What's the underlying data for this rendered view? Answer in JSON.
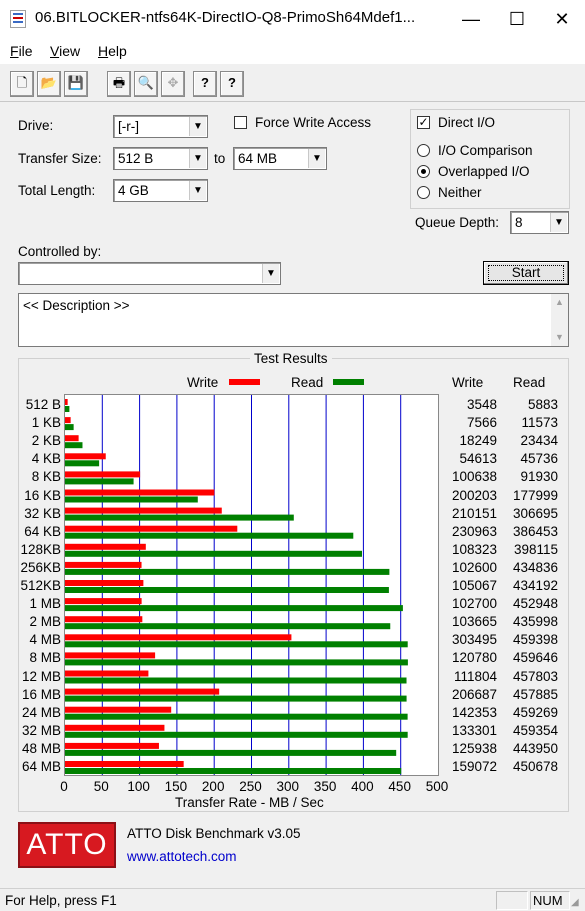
{
  "window": {
    "title": "06.BITLOCKER-ntfs64K-DirectIO-Q8-PrimoSh64Mdef1...",
    "minimize_glyph": "—",
    "maximize_glyph": "☐",
    "close_glyph": "✕"
  },
  "menu": [
    {
      "key": "F",
      "rest": "ile"
    },
    {
      "key": "V",
      "rest": "iew"
    },
    {
      "key": "H",
      "rest": "elp"
    }
  ],
  "toolbar": {
    "icons": [
      "new-file-icon",
      "open-folder-icon",
      "save-icon",
      "print-icon",
      "print-preview-icon",
      "move-icon",
      "help-icon",
      "context-help-icon"
    ],
    "glyphs": [
      "🗋",
      "📂",
      "💾",
      "🖶",
      "🔍",
      "✥",
      "?",
      "?"
    ]
  },
  "form": {
    "drive_label": "Drive:",
    "drive_value": "[-r-]",
    "force_write_label": "Force Write Access",
    "force_write_checked": false,
    "direct_io_label": "Direct I/O",
    "direct_io_checked": true,
    "transfer_size_label": "Transfer Size:",
    "transfer_from": "512 B",
    "to_label": "to",
    "transfer_to": "64 MB",
    "total_length_label": "Total Length:",
    "total_length_value": "4 GB",
    "io_comparison_label": "I/O Comparison",
    "overlapped_io_label": "Overlapped I/O",
    "neither_label": "Neither",
    "selected_mode": "Overlapped I/O",
    "queue_depth_label": "Queue Depth:",
    "queue_depth_value": "8",
    "controlled_by_label": "Controlled by:",
    "controlled_by_value": "",
    "start_label": "Start",
    "description": "<< Description >>"
  },
  "results": {
    "title": "Test Results",
    "legend_write": "Write",
    "legend_read": "Read",
    "col_write": "Write",
    "col_read": "Read",
    "rows": [
      {
        "size": "512 B",
        "write": "3548",
        "read": "5883"
      },
      {
        "size": "1 KB",
        "write": "7566",
        "read": "11573"
      },
      {
        "size": "2 KB",
        "write": "18249",
        "read": "23434"
      },
      {
        "size": "4 KB",
        "write": "54613",
        "read": "45736"
      },
      {
        "size": "8 KB",
        "write": "100638",
        "read": "91930"
      },
      {
        "size": "16 KB",
        "write": "200203",
        "read": "177999"
      },
      {
        "size": "32 KB",
        "write": "210151",
        "read": "306695"
      },
      {
        "size": "64 KB",
        "write": "230963",
        "read": "386453"
      },
      {
        "size": "128KB",
        "write": "108323",
        "read": "398115"
      },
      {
        "size": "256KB",
        "write": "102600",
        "read": "434836"
      },
      {
        "size": "512KB",
        "write": "105067",
        "read": "434192"
      },
      {
        "size": "1 MB",
        "write": "102700",
        "read": "452948"
      },
      {
        "size": "2 MB",
        "write": "103665",
        "read": "435998"
      },
      {
        "size": "4 MB",
        "write": "303495",
        "read": "459398"
      },
      {
        "size": "8 MB",
        "write": "120780",
        "read": "459646"
      },
      {
        "size": "12 MB",
        "write": "111804",
        "read": "457803"
      },
      {
        "size": "16 MB",
        "write": "206687",
        "read": "457885"
      },
      {
        "size": "24 MB",
        "write": "142353",
        "read": "459269"
      },
      {
        "size": "32 MB",
        "write": "133301",
        "read": "459354"
      },
      {
        "size": "48 MB",
        "write": "125938",
        "read": "443950"
      },
      {
        "size": "64 MB",
        "write": "159072",
        "read": "450678"
      }
    ]
  },
  "chart_data": {
    "type": "bar",
    "orientation": "horizontal",
    "categories": [
      "512 B",
      "1 KB",
      "2 KB",
      "4 KB",
      "8 KB",
      "16 KB",
      "32 KB",
      "64 KB",
      "128KB",
      "256KB",
      "512KB",
      "1 MB",
      "2 MB",
      "4 MB",
      "8 MB",
      "12 MB",
      "16 MB",
      "24 MB",
      "32 MB",
      "48 MB",
      "64 MB"
    ],
    "series": [
      {
        "name": "Write",
        "color": "#ff0000",
        "values": [
          3.548,
          7.566,
          18.249,
          54.613,
          100.638,
          200.203,
          210.151,
          230.963,
          108.323,
          102.6,
          105.067,
          102.7,
          103.665,
          303.495,
          120.78,
          111.804,
          206.687,
          142.353,
          133.301,
          125.938,
          159.072
        ]
      },
      {
        "name": "Read",
        "color": "#008000",
        "values": [
          5.883,
          11.573,
          23.434,
          45.736,
          91.93,
          177.999,
          306.695,
          386.453,
          398.115,
          434.836,
          434.192,
          452.948,
          435.998,
          459.398,
          459.646,
          457.803,
          457.885,
          459.269,
          459.354,
          443.95,
          450.678
        ]
      }
    ],
    "xlabel": "Transfer Rate - MB / Sec",
    "xlim": [
      0,
      500
    ],
    "xticks": [
      "0",
      "50",
      "100",
      "150",
      "200",
      "250",
      "300",
      "350",
      "400",
      "450",
      "500"
    ],
    "grid_color": "#0000cc"
  },
  "footer": {
    "logo_text": "ATTO",
    "app_name": "ATTO Disk Benchmark v3.05",
    "url": "www.attotech.com"
  },
  "status": {
    "help_text": "For Help, press F1",
    "num_indicator": "NUM"
  }
}
